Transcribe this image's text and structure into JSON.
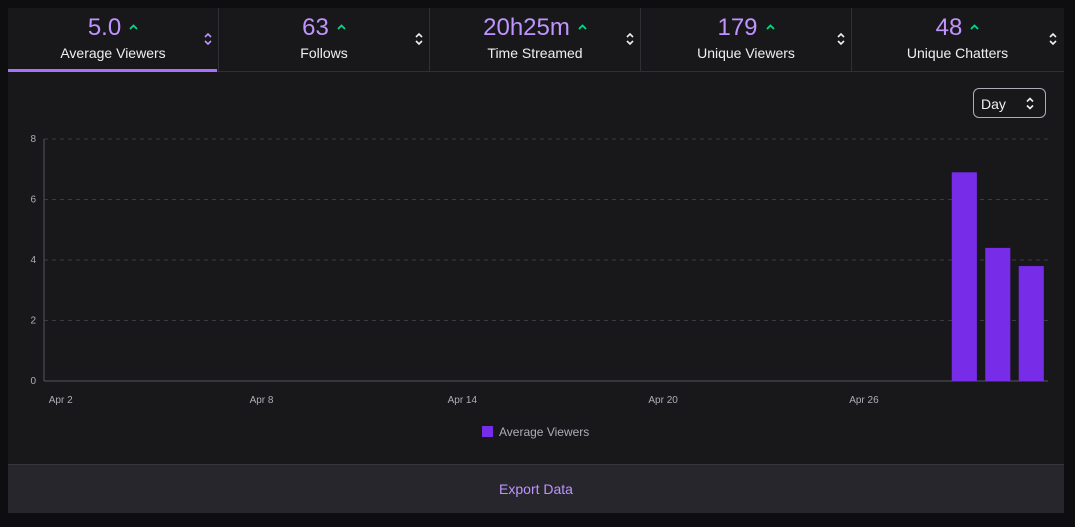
{
  "stats": [
    {
      "value": "5.0",
      "label": "Average Viewers",
      "trend": "up",
      "active": true
    },
    {
      "value": "63",
      "label": "Follows",
      "trend": "up",
      "active": false
    },
    {
      "value": "20h25m",
      "label": "Time Streamed",
      "trend": "up",
      "active": false
    },
    {
      "value": "179",
      "label": "Unique Viewers",
      "trend": "up",
      "active": false
    },
    {
      "value": "48",
      "label": "Unique Chatters",
      "trend": "up",
      "active": false
    }
  ],
  "period_select": {
    "value": "Day"
  },
  "export": {
    "label": "Export Data"
  },
  "colors": {
    "accent": "#bf94ff",
    "bar": "#772ce8",
    "trend_up": "#00db84",
    "background": "#18181b"
  },
  "icons": {
    "trend": "caret-up-icon",
    "sort": "sort-arrows-icon"
  },
  "chart_data": {
    "type": "bar",
    "series": [
      {
        "name": "Average Viewers",
        "x": [
          "Apr 29",
          "Apr 30",
          "May 1"
        ],
        "values": [
          6.9,
          4.4,
          3.8
        ]
      }
    ],
    "x_ticks": [
      "Apr 2",
      "Apr 8",
      "Apr 14",
      "Apr 20",
      "Apr 26"
    ],
    "xlim": [
      "Apr 2",
      "May 1"
    ],
    "y_ticks": [
      "0",
      "2",
      "4",
      "6",
      "8"
    ],
    "ylim": [
      0,
      8
    ],
    "grid": true,
    "legend": "bottom"
  }
}
